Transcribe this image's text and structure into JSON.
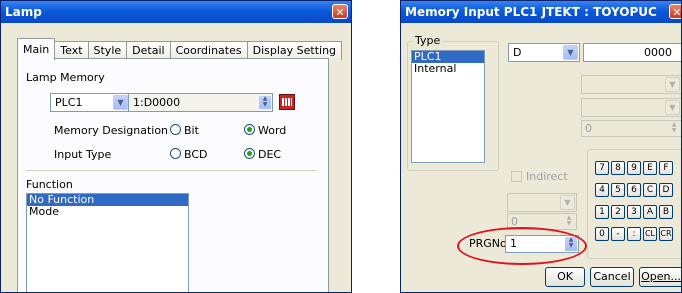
{
  "lamp": {
    "title": "Lamp",
    "tabs": [
      "Main",
      "Text",
      "Style",
      "Detail",
      "Coordinates",
      "Display Setting"
    ],
    "memory_label": "Lamp Memory",
    "plc_value": "PLC1",
    "address_value": "1:D0000",
    "memory_designation_label": "Memory Designation",
    "opt_bit": "Bit",
    "opt_word": "Word",
    "input_type_label": "Input Type",
    "opt_bcd": "BCD",
    "opt_dec": "DEC",
    "function_label": "Function",
    "function_items": [
      "No Function",
      "Mode"
    ]
  },
  "memory_input": {
    "title": "Memory Input  PLC1  JTEKT : TOYOPUC",
    "type_label": "Type",
    "type_items": [
      "PLC1",
      "Internal"
    ],
    "device_value": "D",
    "address_value": "0000",
    "spin_value": "0",
    "indirect_label": "Indirect",
    "indirect_value": "0",
    "keypad_rows": [
      [
        "7",
        "8",
        "9",
        "E",
        "F"
      ],
      [
        "4",
        "5",
        "6",
        "C",
        "D"
      ],
      [
        "1",
        "2",
        "3",
        "A",
        "B"
      ],
      [
        "0",
        "-",
        ":",
        "CL",
        "CR"
      ]
    ],
    "prgno_label": "PRGNo",
    "prgno_value": "1",
    "ok_label": "OK",
    "cancel_label": "Cancel",
    "open_label": "Open..."
  },
  "colors": {
    "title_blue": "#0a5ad8",
    "highlight_circle": "#e0151b",
    "selection": "#316ac5"
  }
}
